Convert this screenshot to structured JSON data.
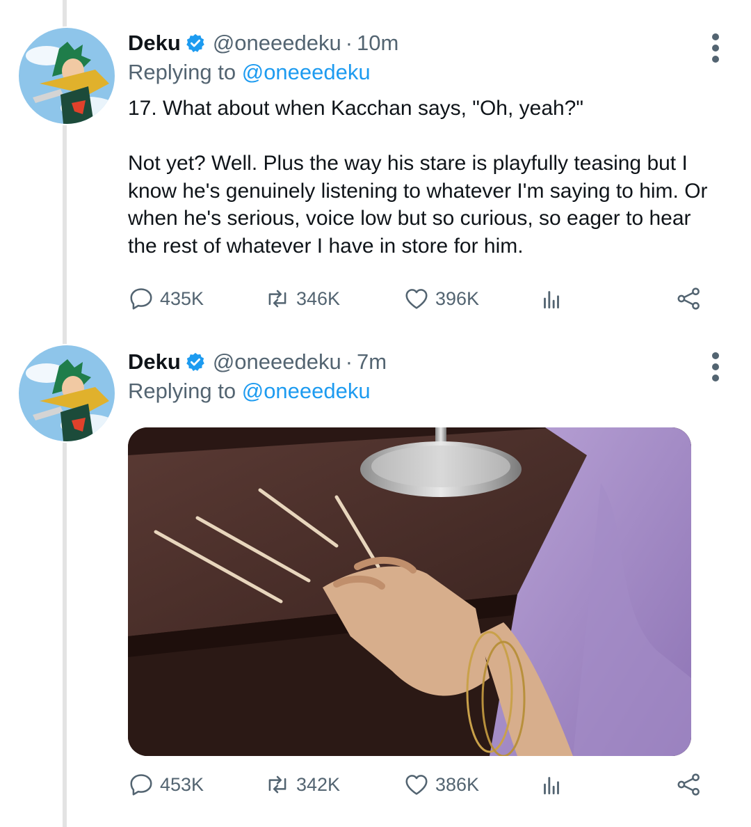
{
  "tweets": [
    {
      "name": "Deku",
      "handle": "@oneeedeku",
      "separator": "·",
      "time": "10m",
      "replying_prefix": "Replying to",
      "replying_to": "@oneeedeku",
      "text": "17. What about when Kacchan says, \"Oh, yeah?\"\n\nNot yet? Well. Plus the way his stare is playfully teasing but I know he's genuinely listening to whatever I'm saying to him. Or when he's serious, voice low but so curious, so eager to hear the rest of whatever I have in store for him.",
      "replies": "435K",
      "retweets": "346K",
      "likes": "396K"
    },
    {
      "name": "Deku",
      "handle": "@oneeedeku",
      "separator": "·",
      "time": "7m",
      "replying_prefix": "Replying to",
      "replying_to": "@oneeedeku",
      "media": "photo of a hand scratching claw marks into a wooden nightstand",
      "replies": "453K",
      "retweets": "342K",
      "likes": "386K"
    }
  ],
  "icons": {
    "verified": "verified-badge-icon",
    "more": "more-options-icon",
    "reply": "reply-icon",
    "retweet": "retweet-icon",
    "like": "heart-icon",
    "analytics": "analytics-icon",
    "share": "share-icon"
  },
  "colors": {
    "accent": "#1d9bf0",
    "secondary_text": "#536471"
  }
}
